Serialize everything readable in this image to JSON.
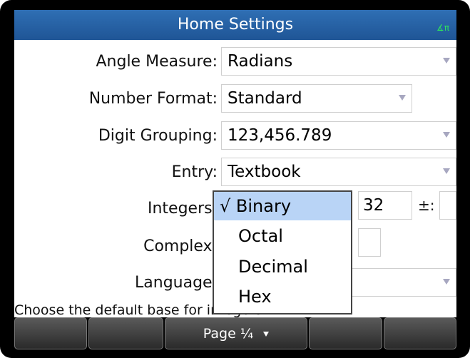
{
  "title": "Home Settings",
  "angle_indicator": "∡π",
  "settings": {
    "angle_measure": {
      "label": "Angle Measure:",
      "value": "Radians"
    },
    "number_format": {
      "label": "Number Format:",
      "value": "Standard"
    },
    "digit_grouping": {
      "label": "Digit Grouping:",
      "value": "123,456.789"
    },
    "entry": {
      "label": "Entry:",
      "value": "Textbook"
    },
    "integers": {
      "label": "Integers:",
      "bits": "32",
      "sign_label": "±:"
    },
    "complex": {
      "label": "Complex:"
    },
    "language": {
      "label": "Language:"
    }
  },
  "popup": {
    "items": [
      "√ Binary",
      "Octal",
      "Decimal",
      "Hex"
    ],
    "selected": "Binary"
  },
  "hint": "Choose the default base for integers",
  "softkeys": [
    "",
    "",
    "Page ¼",
    "",
    ""
  ]
}
